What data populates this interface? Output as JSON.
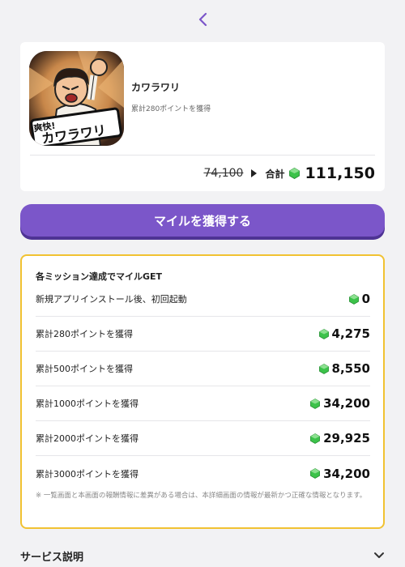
{
  "app": {
    "name": "カワラワリ",
    "description": "累計280ポイントを獲得",
    "icon_text_top": "爽快!",
    "icon_text_main": "カワラワリ"
  },
  "price": {
    "old": "74,100",
    "total_label": "合計",
    "total": "111,150"
  },
  "cta": {
    "label": "マイルを獲得する"
  },
  "missions": {
    "title": "各ミッション達成でマイルGET",
    "items": [
      {
        "label": "新規アプリインストール後、初回起動",
        "reward": "0"
      },
      {
        "label": "累計280ポイントを獲得",
        "reward": "4,275"
      },
      {
        "label": "累計500ポイントを獲得",
        "reward": "8,550"
      },
      {
        "label": "累計1000ポイントを獲得",
        "reward": "34,200"
      },
      {
        "label": "累計2000ポイントを獲得",
        "reward": "29,925"
      },
      {
        "label": "累計3000ポイントを獲得",
        "reward": "34,200"
      }
    ],
    "note": "※ 一覧画面と本画面の報酬情報に差異がある場合は、本詳細画面の情報が最新かつ正確な情報となります。"
  },
  "service": {
    "title": "サービス説明"
  },
  "colors": {
    "accent": "#7b56c9",
    "accent_dark": "#4e3394",
    "mission_border": "#f1c232",
    "gem": "#3cc24a"
  },
  "icons": [
    "back-chevron-icon",
    "gem-icon",
    "triangle-right-icon",
    "chevron-down-icon"
  ]
}
